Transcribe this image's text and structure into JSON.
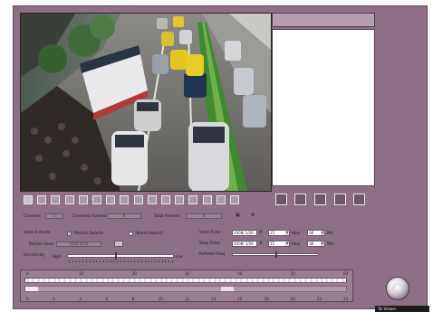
{
  "toolbar": {
    "camera_count": 16,
    "active_camera_index": 0
  },
  "status": {
    "channel_label": "Channel",
    "channel_value": "1",
    "checked_frames_label": "Checked Frames",
    "checked_frames_value": "0",
    "total_frames_label": "Total Frames",
    "total_frames_value": "0"
  },
  "search": {
    "search_mode_label": "Search mode",
    "motion_search_label": "Motion Search",
    "alarm_search_label": "Alarm Search",
    "selected_mode": "motion",
    "motion_area_label": "Motion Area",
    "motion_area_value": "(0,0)-(0,0)",
    "sensitivity_label": "Sensitivity",
    "sensitivity_high": "High",
    "sensitivity_low": "Low",
    "sensitivity_level": 0.45,
    "start_time_label": "Start Time",
    "start_date": "2008/ 3/26",
    "start_hour": "15",
    "start_min": "08",
    "stop_time_label": "Stop Time",
    "stop_date": "2008/ 3/26",
    "stop_hour": "15",
    "stop_min": "38",
    "hour_unit": "Hour",
    "min_unit": "Min",
    "refresh_freq_label": "Refresh Freq",
    "refresh_level": 0.5
  },
  "timeline": {
    "top_ticks": [
      "0",
      "10",
      "20",
      "30",
      "40",
      "50",
      "60"
    ],
    "bottom_ticks": [
      "0",
      "2",
      "4",
      "6",
      "8",
      "10",
      "12",
      "14",
      "16",
      "18",
      "20",
      "22",
      "24"
    ],
    "highlight_start": 0.61,
    "highlight_end": 0.65,
    "lower_marker_start": 0.0,
    "lower_marker_end": 0.04
  },
  "footer": {
    "tag": "Tai Viewer"
  },
  "colors": {
    "window": "#8d6f86",
    "accent": "#b79db0"
  }
}
